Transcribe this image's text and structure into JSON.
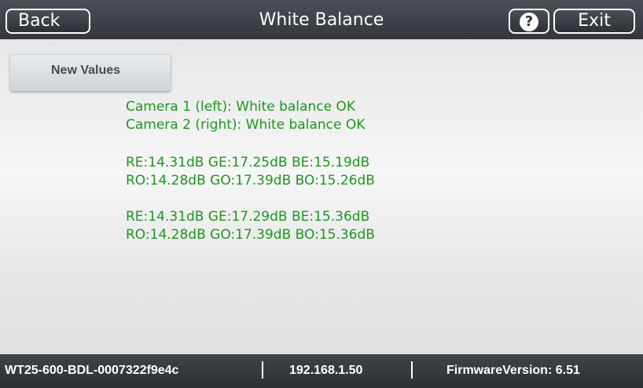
{
  "header": {
    "back_label": "Back",
    "title": "White Balance",
    "help_label": "?",
    "exit_label": "Exit"
  },
  "main": {
    "new_values_label": "New Values",
    "status_lines": [
      "Camera 1 (left): White balance OK",
      "Camera 2 (right): White balance OK"
    ],
    "camera1_values": [
      "RE:14.31dB GE:17.25dB BE:15.19dB",
      "RO:14.28dB GO:17.39dB BO:15.26dB"
    ],
    "camera2_values": [
      "RE:14.31dB GE:17.29dB BE:15.36dB",
      "RO:14.28dB GO:17.39dB BO:15.36dB"
    ]
  },
  "statusbar": {
    "device_id": "WT25-600-BDL-0007322f9e4c",
    "ip_address": "192.168.1.50",
    "firmware": "FirmwareVersion: 6.51"
  },
  "colors": {
    "message_text": "#1a9a1a",
    "bar_background": "#33373c"
  },
  "icons": {
    "help": "help-icon"
  }
}
